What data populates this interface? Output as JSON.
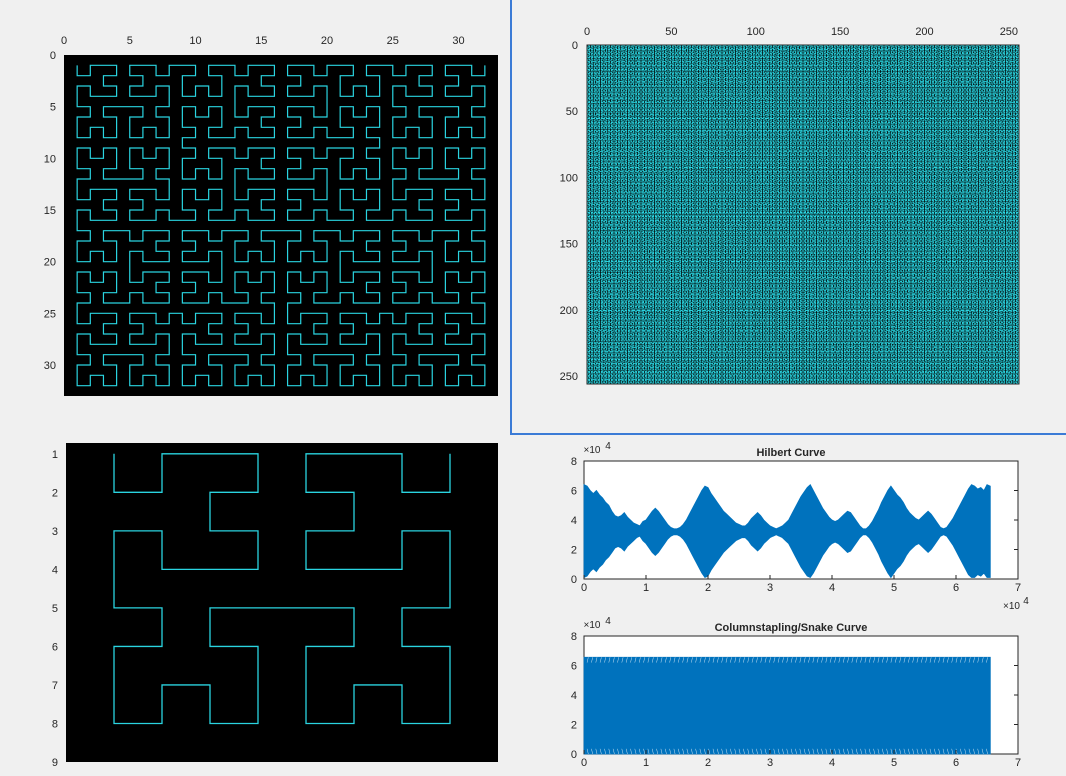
{
  "colors": {
    "curve": "#2ad4e0",
    "field": "#000000",
    "axisText": "#262626",
    "line": "#0072bd",
    "frame": "#3b7bd6"
  },
  "chart_data": [
    {
      "type": "line",
      "title": "",
      "description_panel": "top-left",
      "curve": "hilbert",
      "order": 5,
      "xlim": [
        0,
        33
      ],
      "ylim": [
        0,
        33
      ],
      "y_reversed": true,
      "xticks": [
        "0",
        "5",
        "10",
        "15",
        "20",
        "25",
        "30"
      ],
      "yticks": [
        "0",
        "5",
        "10",
        "15",
        "20",
        "25",
        "30"
      ],
      "grid": false
    },
    {
      "type": "heatmap",
      "title": "",
      "curve": "hilbert",
      "order": 8,
      "xlim": [
        0,
        256
      ],
      "ylim": [
        0,
        256
      ],
      "y_reversed": true,
      "xticks": [
        "0",
        "50",
        "100",
        "150",
        "200",
        "250"
      ],
      "yticks": [
        "0",
        "50",
        "100",
        "150",
        "200",
        "250"
      ],
      "grid": false
    },
    {
      "type": "line",
      "title": "",
      "curve": "hilbert",
      "order": 3,
      "xlim": [
        0,
        9
      ],
      "ylim": [
        1,
        9
      ],
      "y_reversed": true,
      "xticks": [],
      "yticks": [
        "1",
        "2",
        "3",
        "4",
        "5",
        "6",
        "7",
        "8",
        "9"
      ],
      "grid": false
    },
    {
      "type": "area",
      "title": "Hilbert Curve",
      "xlim": [
        0,
        70000
      ],
      "ylim": [
        0,
        80000
      ],
      "xticks": [
        "0",
        "1",
        "2",
        "3",
        "4",
        "5",
        "6",
        "7"
      ],
      "yticks": [
        "0",
        "2",
        "4",
        "6",
        "8"
      ],
      "x_multiplier": "×10",
      "x_exponent": "4",
      "y_multiplier": "×10",
      "y_exponent": "4",
      "series": [
        {
          "x": [
            0,
            500,
            1000,
            1500,
            2000,
            2500,
            3000,
            3500,
            4000,
            4500,
            5000,
            5500,
            6000,
            6500,
            7000,
            7500,
            8000,
            8500,
            9000,
            9500,
            10000,
            10500,
            11000,
            11500,
            12000,
            12500,
            13000,
            13500,
            14000,
            14500,
            15000,
            15500,
            16000,
            16500,
            17000,
            17500,
            18000,
            18500,
            19000,
            19500,
            20000,
            20500,
            21000,
            21500,
            22000,
            22500,
            23000,
            23500,
            24000,
            24500,
            25000,
            25500,
            26000,
            26500,
            27000,
            27500,
            28000,
            28500,
            29000,
            29500,
            30000,
            30500,
            31000,
            31500,
            32000,
            32500,
            33000,
            33500,
            34000,
            34500,
            35000,
            35500,
            36000,
            36500,
            37000,
            37500,
            38000,
            38500,
            39000,
            39500,
            40000,
            40500,
            41000,
            41500,
            42000,
            42500,
            43000,
            43500,
            44000,
            44500,
            45000,
            45500,
            46000,
            46500,
            47000,
            47500,
            48000,
            48500,
            49000,
            49500,
            50000,
            50500,
            51000,
            51500,
            52000,
            52500,
            53000,
            53500,
            54000,
            54500,
            55000,
            55500,
            56000,
            56500,
            57000,
            57500,
            58000,
            58500,
            59000,
            59500,
            60000,
            60500,
            61000,
            61500,
            62000,
            62500,
            63000,
            63500,
            64000,
            64500,
            65000,
            65536
          ],
          "upper": [
            64000,
            63000,
            60000,
            58000,
            60000,
            57000,
            55000,
            52000,
            50000,
            46000,
            43000,
            42000,
            43000,
            45000,
            42000,
            40000,
            38000,
            37000,
            36000,
            39000,
            40000,
            43000,
            46000,
            48000,
            46000,
            43000,
            40000,
            37000,
            35000,
            34000,
            34000,
            35000,
            37000,
            40000,
            44000,
            48000,
            52000,
            56000,
            60000,
            63000,
            62000,
            58000,
            55000,
            52000,
            49000,
            46000,
            44000,
            42000,
            40000,
            38000,
            37000,
            36000,
            36000,
            38000,
            41000,
            43000,
            45000,
            43000,
            40000,
            38000,
            36000,
            35000,
            34000,
            35000,
            36000,
            38000,
            40000,
            44000,
            48000,
            52000,
            56000,
            59000,
            62000,
            64000,
            60000,
            56000,
            52000,
            48000,
            45000,
            42000,
            40000,
            39000,
            40000,
            42000,
            44000,
            46000,
            45000,
            42000,
            39000,
            36000,
            34000,
            34000,
            36000,
            39000,
            43000,
            47000,
            52000,
            56000,
            60000,
            63000,
            60000,
            57000,
            55000,
            52000,
            48000,
            45000,
            43000,
            41000,
            40000,
            42000,
            44000,
            46000,
            44000,
            41000,
            38000,
            35000,
            34000,
            35000,
            38000,
            41000,
            45000,
            49000,
            53000,
            57000,
            61000,
            64000,
            63000,
            61000,
            62000,
            60000,
            64000,
            63000
          ],
          "lower": [
            1000,
            2000,
            5000,
            7000,
            5000,
            8000,
            10000,
            13000,
            15000,
            18000,
            21000,
            22000,
            21000,
            19000,
            22000,
            24000,
            26000,
            28000,
            29000,
            26000,
            24000,
            21000,
            18000,
            16000,
            18000,
            21000,
            24000,
            27000,
            29000,
            30000,
            30000,
            29000,
            27000,
            24000,
            20000,
            16000,
            12000,
            8000,
            4000,
            1000,
            2000,
            6000,
            9000,
            12000,
            15000,
            18000,
            20000,
            22000,
            24000,
            26000,
            27000,
            28000,
            28000,
            26000,
            23000,
            21000,
            19000,
            21000,
            24000,
            26000,
            28000,
            29000,
            30000,
            29000,
            28000,
            26000,
            24000,
            20000,
            16000,
            12000,
            8000,
            5000,
            2000,
            1000,
            4000,
            8000,
            12000,
            16000,
            19000,
            22000,
            24000,
            25000,
            24000,
            22000,
            20000,
            18000,
            19000,
            22000,
            25000,
            28000,
            30000,
            30000,
            28000,
            25000,
            21000,
            17000,
            12000,
            8000,
            4000,
            1000,
            4000,
            7000,
            9000,
            12000,
            16000,
            19000,
            21000,
            23000,
            24000,
            22000,
            20000,
            18000,
            20000,
            23000,
            26000,
            29000,
            30000,
            29000,
            26000,
            23000,
            19000,
            15000,
            11000,
            7000,
            3000,
            1000,
            1000,
            3000,
            2000,
            4000,
            1000,
            1000
          ]
        }
      ]
    },
    {
      "type": "area",
      "title": "Columnstapling/Snake Curve",
      "xlim": [
        0,
        70000
      ],
      "ylim": [
        0,
        80000
      ],
      "xticks": [
        "0",
        "1",
        "2",
        "3",
        "4",
        "5",
        "6",
        "7"
      ],
      "yticks": [
        "0",
        "2",
        "4",
        "6",
        "8"
      ],
      "y_multiplier": "×10",
      "y_exponent": "4",
      "series": [
        {
          "x": [
            0,
            65536
          ],
          "upper": [
            65536,
            65536
          ],
          "lower": [
            0,
            0
          ]
        }
      ]
    }
  ]
}
